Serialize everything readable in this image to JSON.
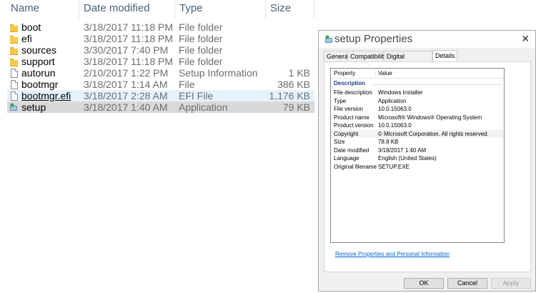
{
  "explorer": {
    "headers": {
      "name": "Name",
      "date": "Date modified",
      "type": "Type",
      "size": "Size"
    },
    "rows": [
      {
        "name": "boot",
        "date": "3/18/2017 11:18 PM",
        "type": "File folder",
        "size": "",
        "icon": "folder-icon"
      },
      {
        "name": "efi",
        "date": "3/18/2017 11:18 PM",
        "type": "File folder",
        "size": "",
        "icon": "folder-icon"
      },
      {
        "name": "sources",
        "date": "3/30/2017 7:40 PM",
        "type": "File folder",
        "size": "",
        "icon": "folder-icon"
      },
      {
        "name": "support",
        "date": "3/18/2017 11:18 PM",
        "type": "File folder",
        "size": "",
        "icon": "folder-icon"
      },
      {
        "name": "autorun",
        "date": "2/10/2017 1:22 PM",
        "type": "Setup Information",
        "size": "1 KB",
        "icon": "setup-info-icon"
      },
      {
        "name": "bootmgr",
        "date": "3/18/2017 1:14 AM",
        "type": "File",
        "size": "386 KB",
        "icon": "file-icon"
      },
      {
        "name": "bootmgr.efi",
        "date": "3/18/2017 2:28 AM",
        "type": "EFI File",
        "size": "1,176 KB",
        "icon": "file-icon"
      },
      {
        "name": "setup",
        "date": "3/18/2017 1:40 AM",
        "type": "Application",
        "size": "79 KB",
        "icon": "setup-app-icon"
      }
    ]
  },
  "dialog": {
    "title": "setup Properties",
    "close": "✕",
    "tabs": [
      "General",
      "Compatibility",
      "Digital Signatures",
      "Details"
    ],
    "active_tab": "Details",
    "columns": {
      "property": "Property",
      "value": "Value"
    },
    "section": "Description",
    "properties": [
      {
        "name": "File description",
        "value": "Windows Installer"
      },
      {
        "name": "Type",
        "value": "Application"
      },
      {
        "name": "File version",
        "value": "10.0.15063.0"
      },
      {
        "name": "Product name",
        "value": "Microsoft® Windows® Operating System"
      },
      {
        "name": "Product version",
        "value": "10.0.15063.0"
      },
      {
        "name": "Copyright",
        "value": "© Microsoft Corporation. All rights reserved."
      },
      {
        "name": "Size",
        "value": "78.8 KB"
      },
      {
        "name": "Date modified",
        "value": "3/18/2017 1:40 AM"
      },
      {
        "name": "Language",
        "value": "English (United States)"
      },
      {
        "name": "Original filename",
        "value": "SETUP.EXE"
      }
    ],
    "link": "Remove Properties and Personal Information",
    "buttons": {
      "ok": "OK",
      "cancel": "Cancel",
      "apply": "Apply"
    }
  },
  "colors": {
    "selection": "#d9d9d9",
    "hover": "#e5f3ff",
    "link": "#0066cc",
    "header_text": "#4c607a"
  }
}
